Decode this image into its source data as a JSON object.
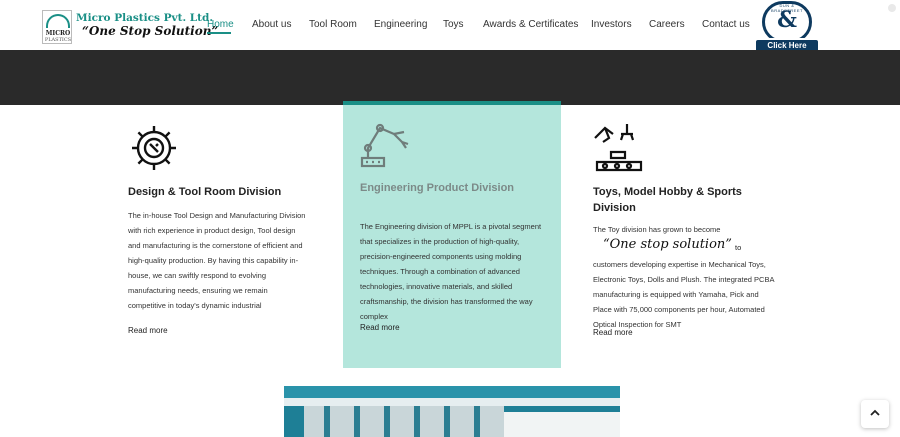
{
  "brand": {
    "name": "Micro Plastics Pvt. Ltd.",
    "tagline": "“One Stop Solution”",
    "mark_text": "MICRO",
    "mark_subtext": "PLASTICS"
  },
  "nav": {
    "items": [
      {
        "label": "Home",
        "active": true
      },
      {
        "label": "About us"
      },
      {
        "label": "Tool Room"
      },
      {
        "label": "Engineering"
      },
      {
        "label": "Toys"
      },
      {
        "label": "Awards & Certificates"
      },
      {
        "label": "Investors"
      },
      {
        "label": "Careers"
      },
      {
        "label": "Contact us"
      }
    ]
  },
  "badge": {
    "ring_text": "DUN & BRADSTREET",
    "symbol": "&",
    "cta": "Click Here"
  },
  "divisions": [
    {
      "icon": "gear-wrench-icon",
      "title": "Design & Tool Room Division",
      "body": "The in-house Tool Design and Manufacturing Division with rich experience in product design, Tool design and manufacturing is the cornerstone of efficient and high-quality production. By having this capability in-house, we can swiftly respond to evolving manufacturing needs, ensuring we remain competitive in today's dynamic industrial",
      "more": "Read more"
    },
    {
      "icon": "robot-arm-icon",
      "title": "Engineering Product Division",
      "body": "The Engineering division of MPPL is a pivotal segment that specializes in the production of high-quality, precision-engineered components using molding techniques. Through a combination of advanced technologies, innovative materials, and skilled craftsmanship, the division has transformed the way complex",
      "more": "Read more"
    },
    {
      "icon": "assembly-line-icon",
      "title": "Toys, Model Hobby & Sports Division",
      "body_pre": "The Toy division has grown to become",
      "quote": "“One stop solution”",
      "body_to": "to",
      "body_post": "customers developing expertise in Mechanical Toys, Electronic Toys, Dolls and Plush. The integrated PCBA manufacturing is equipped with Yamaha, Pick and Place with 75,000 components per hour, Automated Optical Inspection for SMT",
      "more": "Read more"
    }
  ],
  "colors": {
    "accent": "#1a8f86",
    "highlight": "#b4e6dc",
    "banner": "#2a2a2a",
    "badge": "#0e3a5f"
  },
  "scroll_top": "^"
}
